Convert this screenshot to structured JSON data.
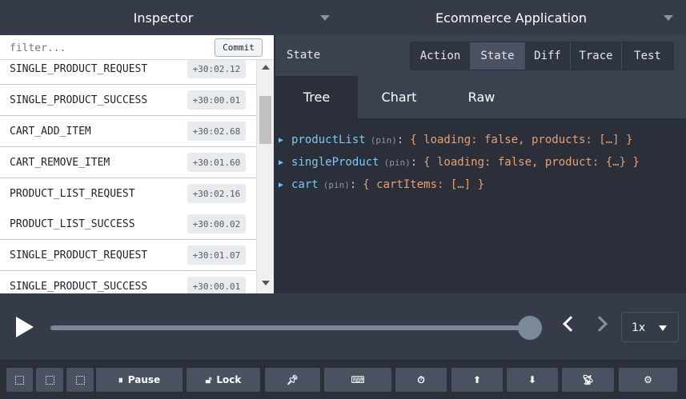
{
  "header": {
    "left_title": "Inspector",
    "right_title": "Ecommerce Application"
  },
  "filter": {
    "placeholder": "filter...",
    "commit_label": "Commit"
  },
  "actions": [
    {
      "name": "SINGLE_PRODUCT_REQUEST",
      "time": "+30:02.12"
    },
    {
      "name": "SINGLE_PRODUCT_SUCCESS",
      "time": "+30:00.01"
    },
    {
      "name": "CART_ADD_ITEM",
      "time": "+30:02.68"
    },
    {
      "name": "CART_REMOVE_ITEM",
      "time": "+30:01.60"
    },
    {
      "name": "PRODUCT_LIST_REQUEST",
      "time": "+30:02.16"
    },
    {
      "name": "PRODUCT_LIST_SUCCESS",
      "time": "+30:00.02"
    },
    {
      "name": "SINGLE_PRODUCT_REQUEST",
      "time": "+30:01.07"
    },
    {
      "name": "SINGLE_PRODUCT_SUCCESS",
      "time": "+30:00.01"
    }
  ],
  "state_panel": {
    "title": "State",
    "mode_tabs": [
      "Action",
      "State",
      "Diff",
      "Trace",
      "Test"
    ],
    "active_mode": "State",
    "view_tabs": [
      "Tree",
      "Chart",
      "Raw"
    ],
    "active_view": "Tree"
  },
  "tree": [
    {
      "key": "productList",
      "pin": "(pin)",
      "colon": ":",
      "value": "{ loading: false, products: […] }"
    },
    {
      "key": "singleProduct",
      "pin": "(pin)",
      "colon": ":",
      "value": "{ loading: false, product: {…} }"
    },
    {
      "key": "cart",
      "pin": "(pin)",
      "colon": ":",
      "value": "{ cartItems: […] }"
    }
  ],
  "slider": {
    "progress": 1.0,
    "speed": "1x"
  },
  "toolbar": {
    "pause_label": "Pause",
    "lock_label": "Lock"
  },
  "icons": {
    "play": "play-icon",
    "prev": "chevron-left-icon",
    "next": "chevron-right-icon",
    "pin": "pushpin-icon",
    "keyboard": "keyboard-icon",
    "timer": "stopwatch-icon",
    "upload": "upload-icon",
    "download": "download-icon",
    "remote": "broadcast-icon",
    "settings": "gear-icon"
  },
  "colors": {
    "background": "#2a2f3a",
    "header": "#353b48",
    "accent_key": "#7dc9f5",
    "value_text": "#e8a070"
  }
}
